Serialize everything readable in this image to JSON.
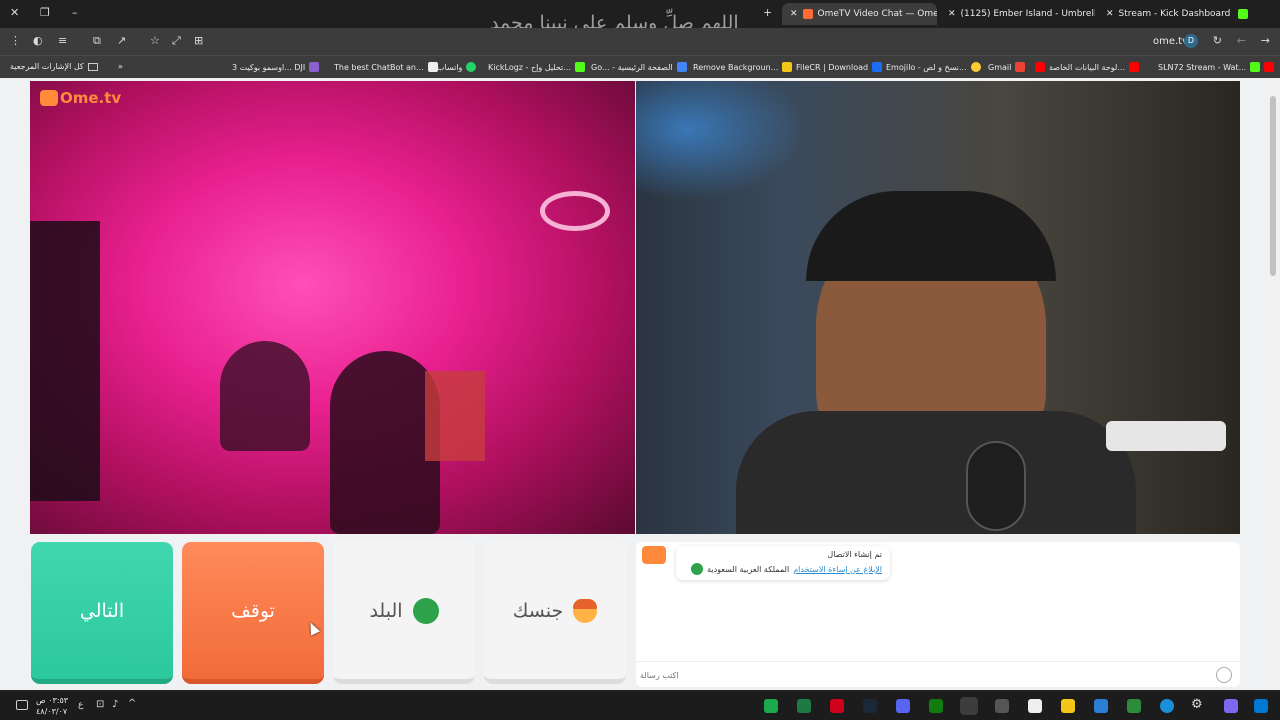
{
  "overlay_text": "اللهم صلِّ وسلم على نبينا محمد",
  "tabs": [
    {
      "label": "OmeTV Video Chat — Ome",
      "color": "#ff6b35",
      "active": true
    },
    {
      "label": "(1125) Ember Island - Umbrella",
      "color": "#ff0000",
      "active": false
    },
    {
      "label": "Stream - Kick Dashboard",
      "color": "#53fc18",
      "active": false
    }
  ],
  "toolbar": {
    "domain": "ome.tv",
    "avatar": "D"
  },
  "bookmarks": [
    {
      "label": "كل الإشارات المرجعية"
    },
    {
      "label": "اوسمو بوكيت 3... DJI"
    },
    {
      "label": "The best ChatBot an..."
    },
    {
      "label": "واتساب"
    },
    {
      "label": "KickLogz - تحليل وإح..."
    },
    {
      "label": "Go... - الصفحة الرئيسية"
    },
    {
      "label": "Remove Backgroun..."
    },
    {
      "label": "FileCR | Download"
    },
    {
      "label": "Emojilo - نسخ و لص..."
    },
    {
      "label": "Gmail"
    },
    {
      "label": "لوحة البيانات الخاصة..."
    },
    {
      "label": "SLN72 Stream - Wat..."
    }
  ],
  "brand": {
    "logo": "Ome.tv",
    "accent": "#ff8a3c"
  },
  "buttons": {
    "next": "التالي",
    "stop": "توقف",
    "country": "البلد",
    "gender": "جنسك"
  },
  "chat": {
    "system_line1": "تم إنشاء الاتصال",
    "report_link": "الإبلاغ عن إساءة الاستخدام",
    "country_name": "المملكة العربية السعودية",
    "input_placeholder": "اكتب رسالة"
  },
  "taskbar": {
    "time": "٠٣:٥٣ ص",
    "date": "٤٨/٠٣/٠٧",
    "lang": "ع"
  }
}
